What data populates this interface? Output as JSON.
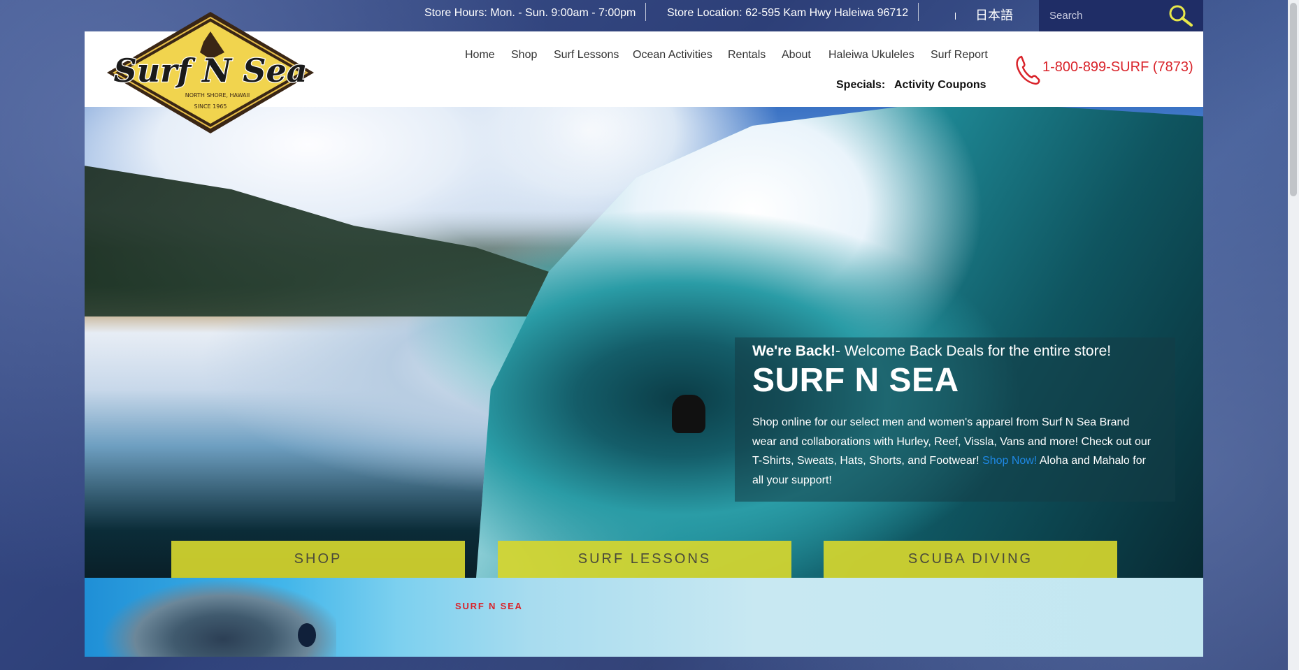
{
  "topbar": {
    "store_hours": "Store Hours: Mon. - Sun. 9:00am - 7:00pm",
    "store_location": "Store Location: 62-595 Kam Hwy Haleiwa 96712",
    "language": "日本語",
    "search_placeholder": "Search"
  },
  "header": {
    "logo_alt": "Surf N Sea",
    "logo_text": "Surf N Sea",
    "logo_sub1": "NORTH SHORE, HAWAII",
    "logo_sub2": "SINCE 1965",
    "nav": [
      {
        "label": "Home"
      },
      {
        "label": "Shop"
      },
      {
        "label": "Surf Lessons"
      },
      {
        "label": "Ocean Activities"
      },
      {
        "label": "Rentals"
      },
      {
        "label": "About"
      },
      {
        "label": "Haleiwa Ukuleles"
      },
      {
        "label": "Surf Report"
      }
    ],
    "specials_label": "Specials:",
    "coupons_label": "Activity Coupons",
    "phone": "1-800-899-SURF (7873)"
  },
  "hero": {
    "lead_bold": "We're Back!",
    "lead_rest": "- Welcome Back Deals for the entire store!",
    "title": "SURF N SEA",
    "body_pre": "Shop online for our select men and women's apparel from Surf N Sea Brand wear and collaborations with Hurley, Reef, Vissla, Vans and more! Check out our T-Shirts, Sweats, Hats, Shorts, and Footwear! ",
    "shop_now": "Shop Now!",
    "body_post": " Aloha and Mahalo for all your support!",
    "buttons": [
      {
        "label": "SHOP"
      },
      {
        "label": "SURF LESSONS"
      },
      {
        "label": "SCUBA DIVING"
      }
    ]
  },
  "strip": {
    "label": "SURF N SEA"
  },
  "colors": {
    "brand_red": "#d9232a",
    "cta_yellow": "#d6d62e",
    "nav_blue": "#1f2d66",
    "link_blue": "#1e88e5"
  }
}
